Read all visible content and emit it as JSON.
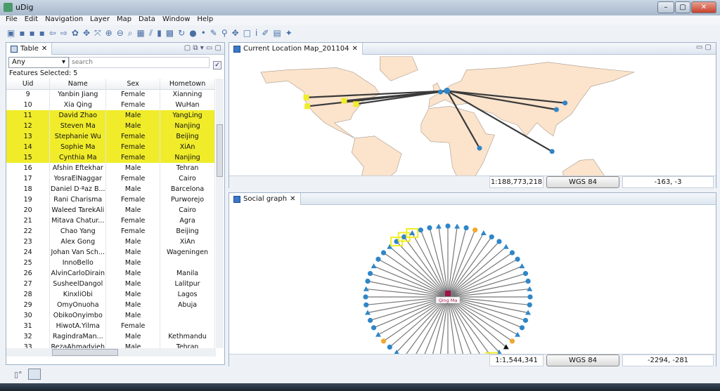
{
  "window": {
    "title": "uDig",
    "minimize": "–",
    "maximize": "▢",
    "close": "✕"
  },
  "menu": [
    "File",
    "Edit",
    "Navigation",
    "Layer",
    "Map",
    "Data",
    "Window",
    "Help"
  ],
  "toolbar_icons": [
    "new-icon",
    "save-icon",
    "save-all-icon",
    "properties-icon",
    "back-icon",
    "forward-icon",
    "refresh-icon",
    "pan-icon",
    "zoom-extent-icon",
    "zoom-in-icon",
    "zoom-out-icon",
    "zoom-selection-icon",
    "layer-icon",
    "chart-line-icon",
    "chart-bar-icon",
    "import-icon",
    "reload-icon",
    "globe-icon",
    "record-icon",
    "edit-icon",
    "search-tool-icon",
    "move-tool-icon",
    "select-box-icon",
    "info-icon",
    "draw-icon",
    "layer-tool-icon",
    "filter-icon"
  ],
  "table_panel": {
    "tab": "Table",
    "filter": "Any",
    "search_placeholder": "search",
    "features_selected": "Features Selected: 5",
    "columns": [
      "Uid",
      "Name",
      "Sex",
      "Hometown"
    ],
    "rows": [
      [
        "9",
        "Yanbin Jiang",
        "Female",
        "Xianning",
        false
      ],
      [
        "10",
        "Xia Qing",
        "Female",
        "WuHan",
        false
      ],
      [
        "11",
        "David Zhao",
        "Male",
        "YangLing",
        true
      ],
      [
        "12",
        "Steven Ma",
        "Male",
        "Nanjing",
        true
      ],
      [
        "13",
        "Stephanie Wu",
        "Female",
        "Beijing",
        true
      ],
      [
        "14",
        "Sophie Ma",
        "Female",
        "XiAn",
        true
      ],
      [
        "15",
        "Cynthia Ma",
        "Female",
        "Nanjing",
        true
      ],
      [
        "16",
        "Afshin Eftekhar",
        "Male",
        "Tehran",
        false
      ],
      [
        "17",
        "YosraElNaggar",
        "Female",
        "Cairo",
        false
      ],
      [
        "18",
        "Daniel D·ªaz B...",
        "Male",
        "Barcelona",
        false
      ],
      [
        "19",
        "Rani Charisma",
        "Female",
        "Purworejo",
        false
      ],
      [
        "20",
        "Waleed TarekAli",
        "Male",
        "Cairo",
        false
      ],
      [
        "21",
        "Mitava Chatur...",
        "Female",
        "Agra",
        false
      ],
      [
        "22",
        "Chao Yang",
        "Female",
        "Beijing",
        false
      ],
      [
        "23",
        "Alex Gong",
        "Male",
        "XiAn",
        false
      ],
      [
        "24",
        "Johan Van Sch...",
        "Male",
        "Wageningen",
        false
      ],
      [
        "25",
        "InnoBello",
        "Male",
        "",
        false
      ],
      [
        "26",
        "AlvinCarloDirain",
        "Male",
        "Manila",
        false
      ],
      [
        "27",
        "SusheelDangol",
        "Male",
        "Lalitpur",
        false
      ],
      [
        "28",
        "KinxliObi",
        "Male",
        "Lagos",
        false
      ],
      [
        "29",
        "OmyOnuoha",
        "Male",
        "Abuja",
        false
      ],
      [
        "30",
        "ObikoOnyimbo",
        "Male",
        "",
        false
      ],
      [
        "31",
        "HiwotA.Yilma",
        "Female",
        "",
        false
      ],
      [
        "32",
        "RagindraMan...",
        "Male",
        "Kethmandu",
        false
      ],
      [
        "33",
        "RezaAhmadyieh",
        "Male",
        "Tehran",
        false
      ]
    ]
  },
  "map_panel": {
    "tab": "Current Location Map_201104",
    "scale": "1:188,773,218",
    "crs": "WGS 84",
    "coords": "-163, -3"
  },
  "graph_panel": {
    "tab": "Social graph",
    "center_label": "Qing Ma",
    "scale": "1:1,544,341",
    "crs": "WGS 84",
    "coords": "-2294, -281"
  },
  "colors": {
    "selection": "#f0ec2a",
    "node": "#2f86c8",
    "land": "#fbe3cc",
    "link": "#3a3a3a",
    "center": "#a0124a",
    "orange": "#f0a830"
  }
}
